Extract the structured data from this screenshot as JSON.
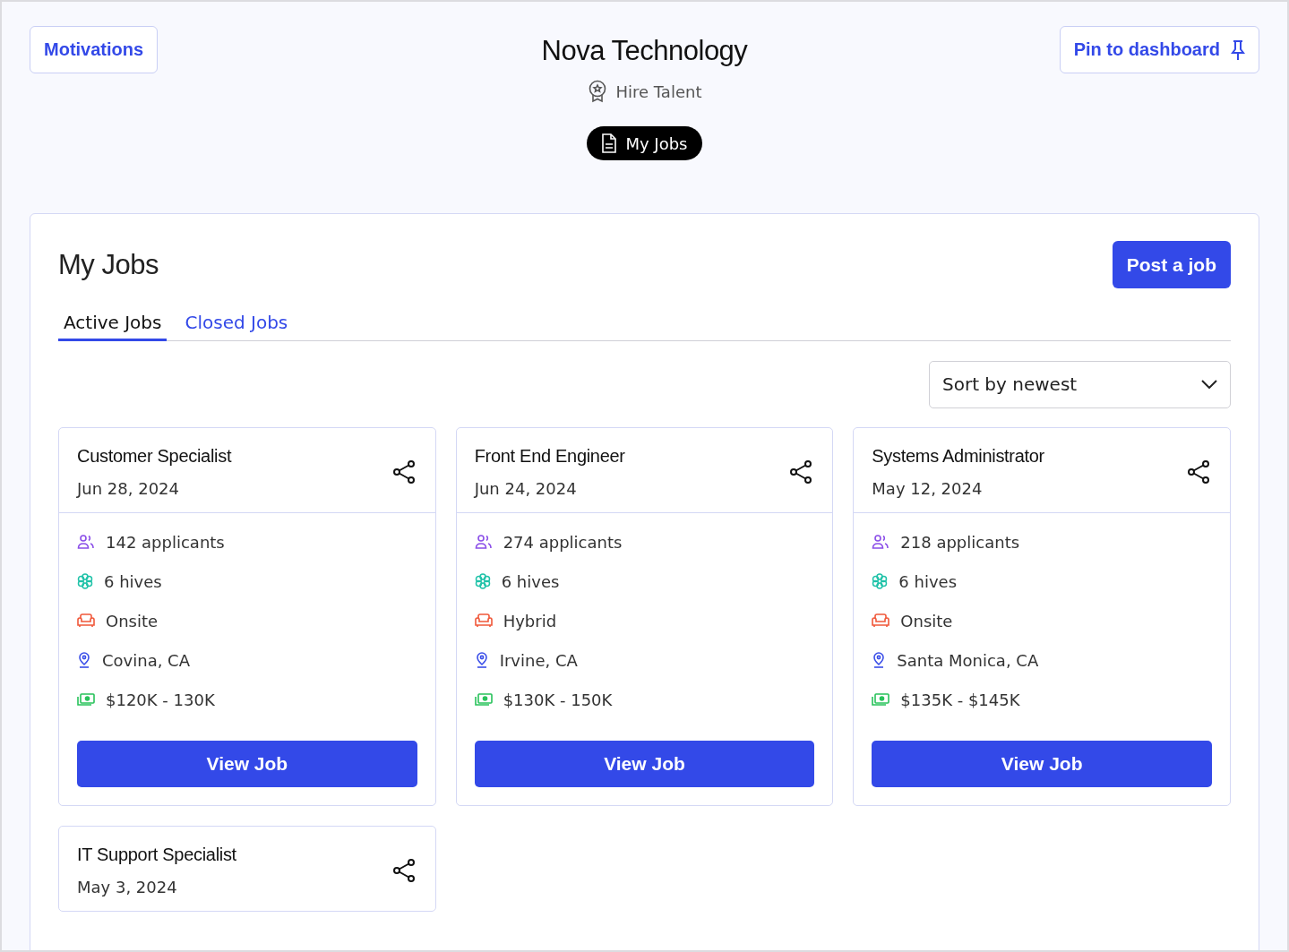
{
  "header": {
    "motivations_button": "Motivations",
    "company": "Nova Technology",
    "subtitle": "Hire Talent",
    "pin_button": "Pin to dashboard",
    "nav_pill": "My Jobs"
  },
  "panel": {
    "title": "My Jobs",
    "post_button": "Post a job",
    "tabs": [
      {
        "label": "Active Jobs",
        "selected": true
      },
      {
        "label": "Closed Jobs",
        "selected": false
      }
    ],
    "sort": {
      "value": "Sort by newest"
    },
    "jobs": [
      {
        "title": "Customer Specialist",
        "date": "Jun 28, 2024",
        "details": [
          {
            "kind": "applicants",
            "text": "142 applicants"
          },
          {
            "kind": "hives",
            "text": "6 hives"
          },
          {
            "kind": "workplace",
            "text": "Onsite"
          },
          {
            "kind": "location",
            "text": "Covina, CA"
          },
          {
            "kind": "salary",
            "text": "$120K - 130K"
          }
        ],
        "button": "View Job"
      },
      {
        "title": "Front End Engineer",
        "date": "Jun 24, 2024",
        "details": [
          {
            "kind": "applicants",
            "text": "274 applicants"
          },
          {
            "kind": "hives",
            "text": "6 hives"
          },
          {
            "kind": "workplace",
            "text": "Hybrid"
          },
          {
            "kind": "location",
            "text": "Irvine, CA"
          },
          {
            "kind": "salary",
            "text": "$130K - 150K"
          }
        ],
        "button": "View Job"
      },
      {
        "title": "Systems Administrator",
        "date": "May 12, 2024",
        "details": [
          {
            "kind": "applicants",
            "text": "218 applicants"
          },
          {
            "kind": "hives",
            "text": "6 hives"
          },
          {
            "kind": "workplace",
            "text": "Onsite"
          },
          {
            "kind": "location",
            "text": "Santa Monica, CA"
          },
          {
            "kind": "salary",
            "text": "$135K - $145K"
          }
        ],
        "button": "View Job"
      },
      {
        "title": "IT Support Specialist",
        "date": "May 3, 2024"
      }
    ]
  }
}
